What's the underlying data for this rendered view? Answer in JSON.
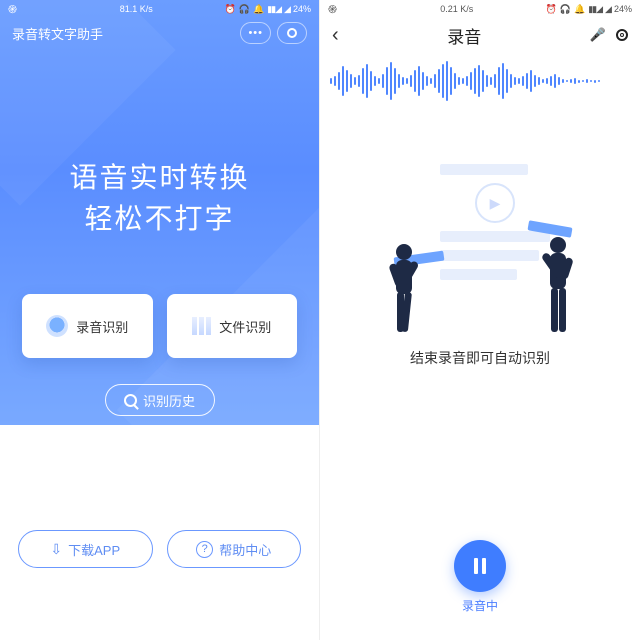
{
  "left": {
    "status": {
      "speed": "81.1 K/s",
      "battery": "24%"
    },
    "title": "录音转文字助手",
    "hero_line1": "语音实时转换",
    "hero_line2": "轻松不打字",
    "card_record": "录音识别",
    "card_file": "文件识别",
    "history": "识别历史",
    "download": "下载APP",
    "help": "帮助中心"
  },
  "right": {
    "status": {
      "speed": "0.21 K/s",
      "battery": "24%"
    },
    "title": "录音",
    "caption": "结束录音即可自动识别",
    "rec_label": "录音中"
  }
}
